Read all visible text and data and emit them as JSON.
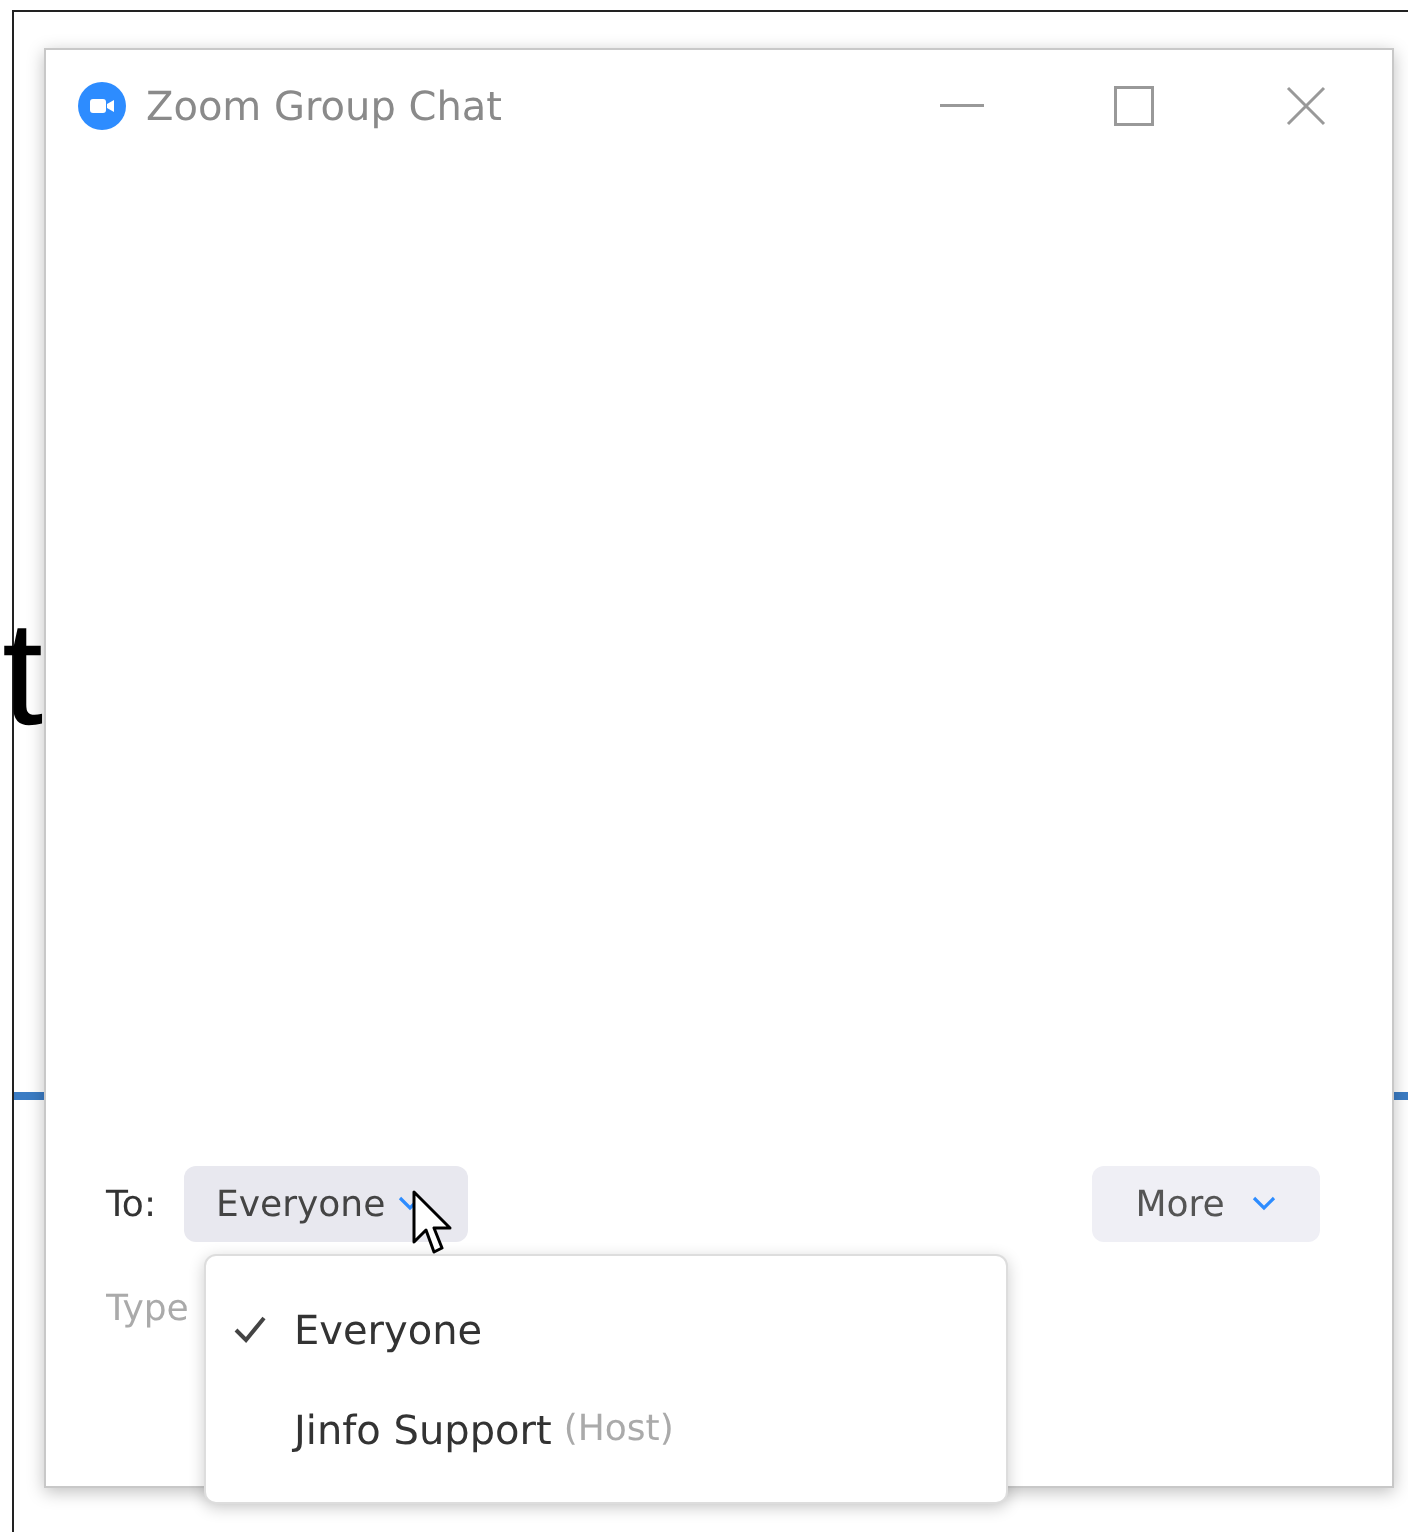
{
  "background": {
    "text": "t"
  },
  "window": {
    "title": "Zoom Group Chat"
  },
  "composer": {
    "to_label": "To:",
    "recipient": "Everyone",
    "more": "More",
    "message": {
      "placeholder": "Type"
    }
  },
  "dropdown": {
    "items": [
      {
        "label": "Everyone",
        "selected": true
      },
      {
        "label": "Jinfo Support",
        "note": "(Host)",
        "selected": false
      }
    ]
  }
}
